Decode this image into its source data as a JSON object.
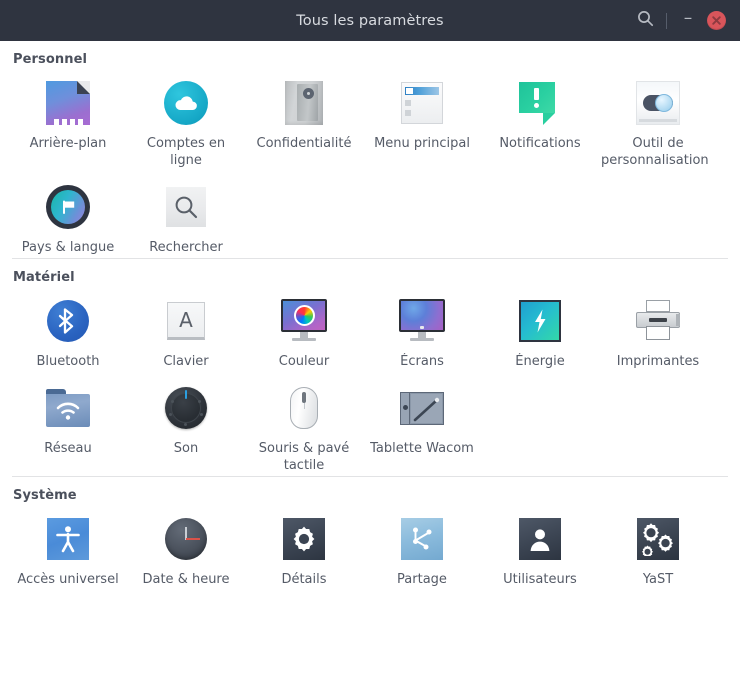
{
  "window": {
    "title": "Tous les paramètres",
    "titlebar_bg": "#2f3440",
    "close_color": "#d9555b",
    "search_icon": "search-icon",
    "minimize_label": "–",
    "close_label": "✕"
  },
  "sections": [
    {
      "id": "personnel",
      "title": "Personnel",
      "show_divider": false,
      "items": [
        {
          "label": "Arrière-plan",
          "icon": "wallpaper-icon"
        },
        {
          "label": "Comptes en ligne",
          "icon": "cloud-accounts-icon"
        },
        {
          "label": "Confidentialité",
          "icon": "privacy-door-icon"
        },
        {
          "label": "Menu principal",
          "icon": "main-menu-window-icon"
        },
        {
          "label": "Notifications",
          "icon": "notification-bubble-icon"
        },
        {
          "label": "Outil de personnalisation",
          "icon": "toggle-switch-icon",
          "clipped": true,
          "line1": "Outil de",
          "line2": "personnalisation"
        },
        {
          "label": "Pays & langue",
          "icon": "region-flag-icon"
        },
        {
          "label": "Rechercher",
          "icon": "search-magnifier-icon"
        }
      ]
    },
    {
      "id": "materiel",
      "title": "Matériel",
      "show_divider": true,
      "items": [
        {
          "label": "Bluetooth",
          "icon": "bluetooth-icon"
        },
        {
          "label": "Clavier",
          "icon": "keyboard-key-icon",
          "glyph": "A"
        },
        {
          "label": "Couleur",
          "icon": "color-wheel-monitor-icon"
        },
        {
          "label": "Écrans",
          "icon": "displays-monitor-icon"
        },
        {
          "label": "Énergie",
          "icon": "power-bolt-icon"
        },
        {
          "label": "Imprimantes",
          "icon": "printer-icon"
        },
        {
          "label": "Réseau",
          "icon": "network-folder-wifi-icon"
        },
        {
          "label": "Son",
          "icon": "sound-knob-icon"
        },
        {
          "label": "Souris & pavé tactile",
          "icon": "mouse-icon"
        },
        {
          "label": "Tablette Wacom",
          "icon": "wacom-tablet-icon"
        }
      ]
    },
    {
      "id": "systeme",
      "title": "Système",
      "show_divider": true,
      "items": [
        {
          "label": "Accès universel",
          "icon": "accessibility-icon"
        },
        {
          "label": "Date & heure",
          "icon": "clock-icon"
        },
        {
          "label": "Détails",
          "icon": "gear-details-icon"
        },
        {
          "label": "Partage",
          "icon": "sharing-nodes-icon"
        },
        {
          "label": "Utilisateurs",
          "icon": "user-silhouette-icon"
        },
        {
          "label": "YaST",
          "icon": "yast-gears-icon"
        }
      ]
    }
  ]
}
